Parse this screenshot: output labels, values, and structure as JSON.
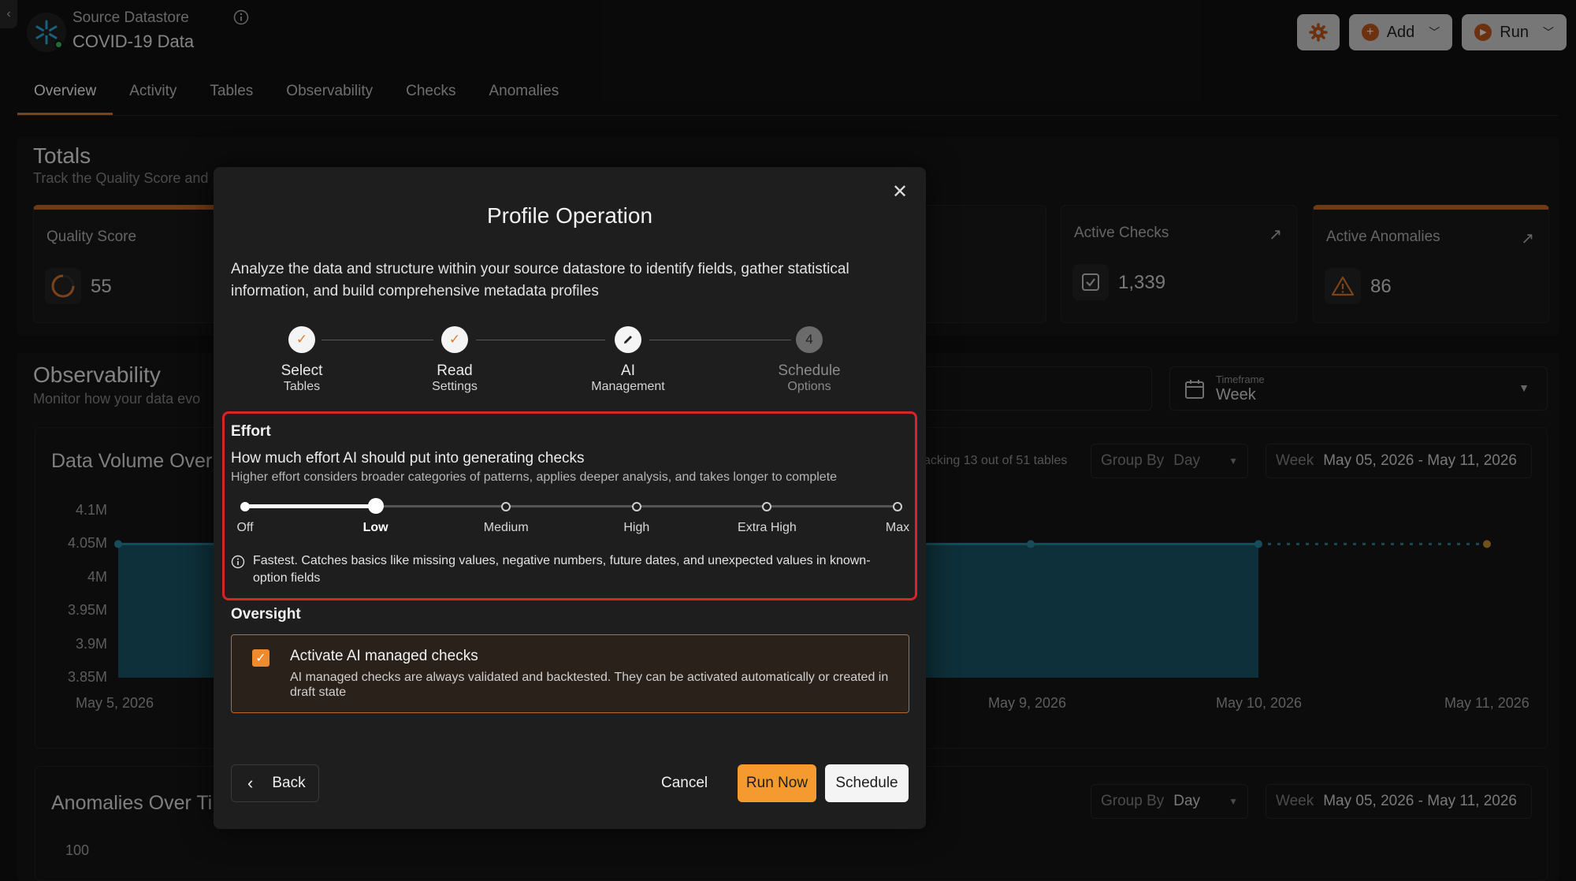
{
  "header": {
    "subtitle": "Source Datastore",
    "title": "COVID-19 Data",
    "add_label": "Add",
    "run_label": "Run"
  },
  "tabs": [
    {
      "label": "Overview",
      "active": true
    },
    {
      "label": "Activity"
    },
    {
      "label": "Tables"
    },
    {
      "label": "Observability"
    },
    {
      "label": "Checks"
    },
    {
      "label": "Anomalies"
    }
  ],
  "totals": {
    "title": "Totals",
    "subtitle": "Track the Quality Score and",
    "quality_label": "Quality Score",
    "quality_value": "55",
    "active_checks_label": "Active Checks",
    "active_checks_value": "1,339",
    "active_anomalies_label": "Active Anomalies",
    "active_anomalies_value": "86"
  },
  "observability": {
    "title": "Observability",
    "subtitle": "Monitor how your data evo",
    "timeframe_label": "Timeframe",
    "timeframe_value": "Week"
  },
  "volume_chart": {
    "title": "Data Volume Over",
    "tracking": "acking 13 out of 51 tables",
    "group_by_label": "Group By",
    "group_by_value": "Day",
    "range_label": "Week",
    "range_value": "May 05, 2026 - May 11, 2026",
    "y_ticks": [
      "4.1M",
      "4.05M",
      "4M",
      "3.95M",
      "3.9M",
      "3.85M"
    ],
    "x_ticks": [
      "May 5, 2026",
      "May 9, 2026",
      "May 10, 2026",
      "May 11, 2026"
    ]
  },
  "chart_data": {
    "type": "area",
    "x": [
      "May 5, 2026",
      "May 9, 2026",
      "May 10, 2026",
      "May 11, 2026"
    ],
    "series": [
      {
        "values": [
          4050000,
          4050000,
          4050000,
          4050000
        ]
      }
    ],
    "ylim": [
      3850000,
      4100000
    ]
  },
  "anomalies_chart": {
    "title": "Anomalies Over Ti",
    "group_by_label": "Group By",
    "group_by_value": "Day",
    "range_label": "Week",
    "range_value": "May 05, 2026 - May 11, 2026",
    "y_first_tick": "100"
  },
  "modal": {
    "title": "Profile Operation",
    "description": "Analyze the data and structure within your source datastore to identify fields, gather statistical information, and build comprehensive metadata profiles",
    "steps": [
      {
        "t1": "Select",
        "t2": "Tables",
        "state": "done"
      },
      {
        "t1": "Read",
        "t2": "Settings",
        "state": "done"
      },
      {
        "t1": "AI",
        "t2": "Management",
        "state": "current"
      },
      {
        "t1": "Schedule",
        "t2": "Options",
        "state": "todo",
        "number": "4"
      }
    ],
    "effort": {
      "heading": "Effort",
      "question": "How much effort AI should put into generating checks",
      "hint": "Higher effort considers broader categories of patterns, applies deeper analysis, and takes longer to complete",
      "levels": [
        "Off",
        "Low",
        "Medium",
        "High",
        "Extra High",
        "Max"
      ],
      "selected_index": 1,
      "selected_fraction": 0.2,
      "note": "Fastest. Catches basics like missing values, negative numbers, future dates, and unexpected values in known-option fields"
    },
    "oversight": {
      "heading": "Oversight",
      "checkbox_title": "Activate AI managed checks",
      "checkbox_desc": "AI managed checks are always validated and backtested. They can be activated automatically or created in draft state",
      "checked": true
    },
    "buttons": {
      "back": "Back",
      "cancel": "Cancel",
      "run_now": "Run Now",
      "schedule": "Schedule"
    }
  },
  "colors": {
    "accent": "#f59a2e",
    "highlight_border": "#d9222a",
    "area_fill": "#1d6f87"
  }
}
